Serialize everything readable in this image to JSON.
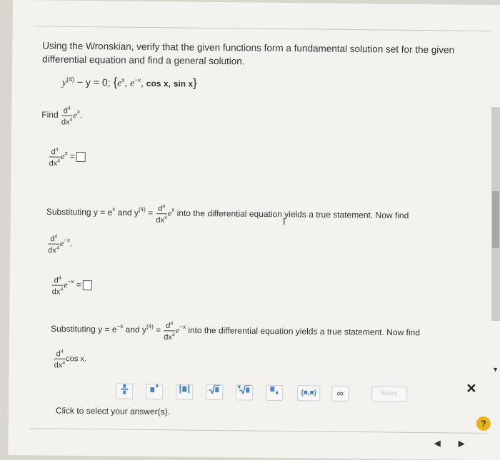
{
  "problem": {
    "statement": "Using the Wronskian, verify that the given functions form a fundamental solution set for the given differential equation and find a general solution.",
    "equation_lhs": "y",
    "equation_order": "(4)",
    "equation_rest": "− y = 0;",
    "set_open": "{",
    "f1": "e",
    "f1_exp": "x",
    "f2": "e",
    "f2_exp": "−x",
    "f3": "cos x,",
    "f4": "sin x",
    "set_close": "}"
  },
  "part1": {
    "find_label": "Find",
    "d_num": "d",
    "d_num_exp": "4",
    "d_den": "dx",
    "d_den_exp": "4",
    "func": "e",
    "func_exp": "x",
    "period": "."
  },
  "substitution1": {
    "prefix": "Substituting y = e",
    "prefix_exp": "x",
    "and": "and y",
    "order": "(4)",
    "eq": "=",
    "func": "e",
    "func_exp": "x",
    "suffix": "into the differential equation yields a true statement. Now find"
  },
  "part2": {
    "func": "e",
    "func_exp": "−x",
    "period": "."
  },
  "substitution2": {
    "prefix": "Substituting y = e",
    "prefix_exp": "−x",
    "and": "and y",
    "order": "(4)",
    "eq": "=",
    "func": "e",
    "func_exp": "−x",
    "suffix": "into the differential equation yields a true statement. Now find"
  },
  "part3": {
    "func": "cos x."
  },
  "toolbar": {
    "buttons": [
      "frac",
      "sup",
      "abs",
      "sqrt",
      "nthroot",
      "sub",
      "(■,■)",
      "∞"
    ],
    "more_label": "More"
  },
  "hint": "Click to select your answer(s).",
  "help_label": "?",
  "close_label": "✕",
  "nav": {
    "prev": "◀",
    "next": "▶"
  },
  "colors": {
    "accent": "#4a86c6",
    "help": "#e9b21c",
    "page": "#f3f2ef"
  }
}
